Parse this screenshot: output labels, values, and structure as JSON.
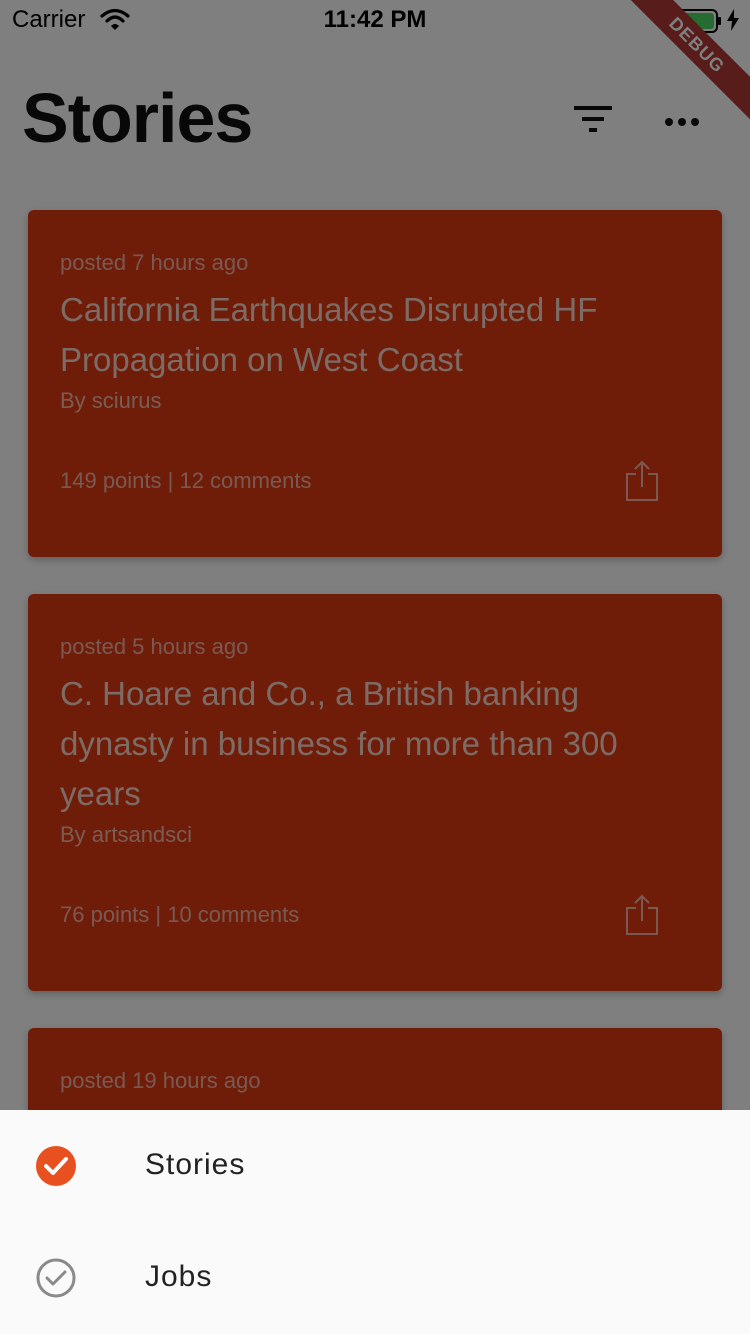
{
  "status_bar": {
    "carrier": "Carrier",
    "time": "11:42 PM",
    "debug_badge": "DEBUG",
    "battery_color": "#4cd964"
  },
  "header": {
    "title": "Stories",
    "filter_icon": "filter-icon",
    "more_icon": "more-horizontal-icon"
  },
  "stories": [
    {
      "posted": "posted 7 hours ago",
      "title": "California Earthquakes Disrupted HF Propagation on West Coast",
      "author": "By sciurus",
      "stats": "149 points | 12 comments"
    },
    {
      "posted": "posted 5 hours ago",
      "title": "C. Hoare and Co., a British banking dynasty in business for more than 300 years",
      "author": "By artsandsci",
      "stats": "76 points | 10 comments"
    },
    {
      "posted": "posted 19 hours ago"
    }
  ],
  "bottom_sheet": {
    "items": [
      {
        "label": "Stories",
        "selected": true,
        "icon": "check-circle-filled-icon"
      },
      {
        "label": "Jobs",
        "selected": false,
        "icon": "check-circle-outline-icon"
      }
    ]
  },
  "colors": {
    "card_background": "#de3b12",
    "accent": "#e8501f",
    "scrim": "rgba(0,0,0,0.5)"
  }
}
